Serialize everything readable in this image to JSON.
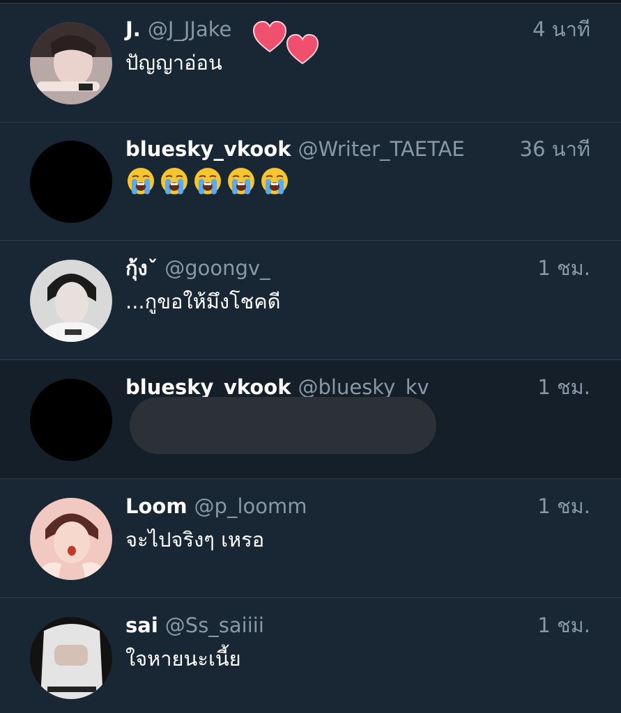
{
  "notifications": [
    {
      "display_name": "J.",
      "handle": "@J_JJake",
      "time": "4 นาที",
      "text": "ปัญญาอ่อน",
      "avatar": "photo-avatar"
    },
    {
      "display_name": "bluesky_vkook",
      "handle": "@Writer_TAETAE",
      "time": "36 นาที",
      "text": "",
      "emojis": [
        "loudly-crying-face",
        "loudly-crying-face",
        "loudly-crying-face",
        "loudly-crying-face",
        "loudly-crying-face"
      ],
      "avatar": "black-avatar"
    },
    {
      "display_name": "กุ้งˇ",
      "handle": "@goongv_",
      "time": "1 ชม.",
      "text": "...กูขอให้มึงโชคดี",
      "avatar": "photo-avatar"
    },
    {
      "display_name": "bluesky_vkook",
      "handle": "@bluesky_kv",
      "time": "1 ชม.",
      "text": "",
      "avatar": "black-avatar",
      "redacted": true
    },
    {
      "display_name": "Loom",
      "handle": "@p_loomm",
      "time": "1 ชม.",
      "text": "จะไปจริงๆ เหรอ",
      "avatar": "photo-avatar"
    },
    {
      "display_name": "sai",
      "handle": "@Ss_saiiii",
      "time": "1 ชม.",
      "text": "ใจหายนะเนี้ย",
      "avatar": "photo-avatar"
    }
  ],
  "colors": {
    "background": "#192734",
    "name": "#ffffff",
    "handle": "#8899a6",
    "heart": "#f0506e",
    "redaction": "#2b3136"
  },
  "decorations": [
    "heart-sticker",
    "heart-sticker"
  ]
}
